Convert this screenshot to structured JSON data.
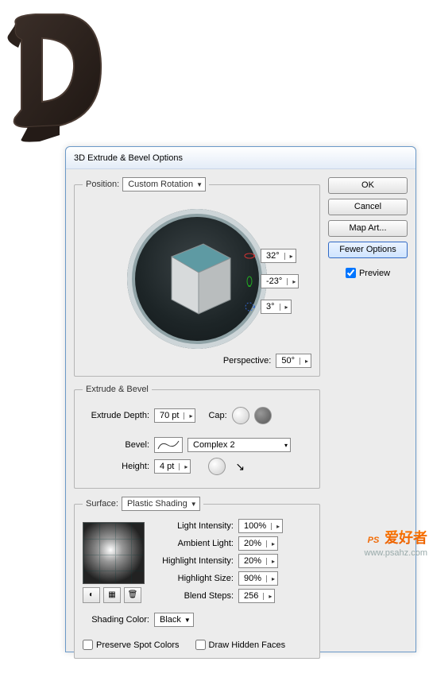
{
  "dialog": {
    "title": "3D Extrude & Bevel Options"
  },
  "buttons": {
    "ok": "OK",
    "cancel": "Cancel",
    "map_art": "Map Art...",
    "fewer_options": "Fewer Options"
  },
  "preview": {
    "label": "Preview",
    "checked": true
  },
  "position": {
    "label": "Position:",
    "value": "Custom Rotation",
    "angle_x": "32°",
    "angle_y": "-23°",
    "angle_z": "3°",
    "perspective_label": "Perspective:",
    "perspective": "50°"
  },
  "extrude": {
    "legend": "Extrude & Bevel",
    "depth_label": "Extrude Depth:",
    "depth": "70 pt",
    "cap_label": "Cap:",
    "bevel_label": "Bevel:",
    "bevel_value": "Complex 2",
    "height_label": "Height:",
    "height": "4 pt"
  },
  "surface": {
    "label": "Surface:",
    "value": "Plastic Shading",
    "light_intensity_label": "Light Intensity:",
    "light_intensity": "100%",
    "ambient_label": "Ambient Light:",
    "ambient": "20%",
    "highlight_intensity_label": "Highlight Intensity:",
    "highlight_intensity": "20%",
    "highlight_size_label": "Highlight Size:",
    "highlight_size": "90%",
    "blend_steps_label": "Blend Steps:",
    "blend_steps": "256",
    "shading_color_label": "Shading Color:",
    "shading_color": "Black",
    "preserve_spot": "Preserve Spot Colors",
    "draw_hidden": "Draw Hidden Faces"
  },
  "watermark": {
    "brand_en": "PS",
    "brand_cn": "爱好者",
    "url": "www.psahz.com"
  }
}
